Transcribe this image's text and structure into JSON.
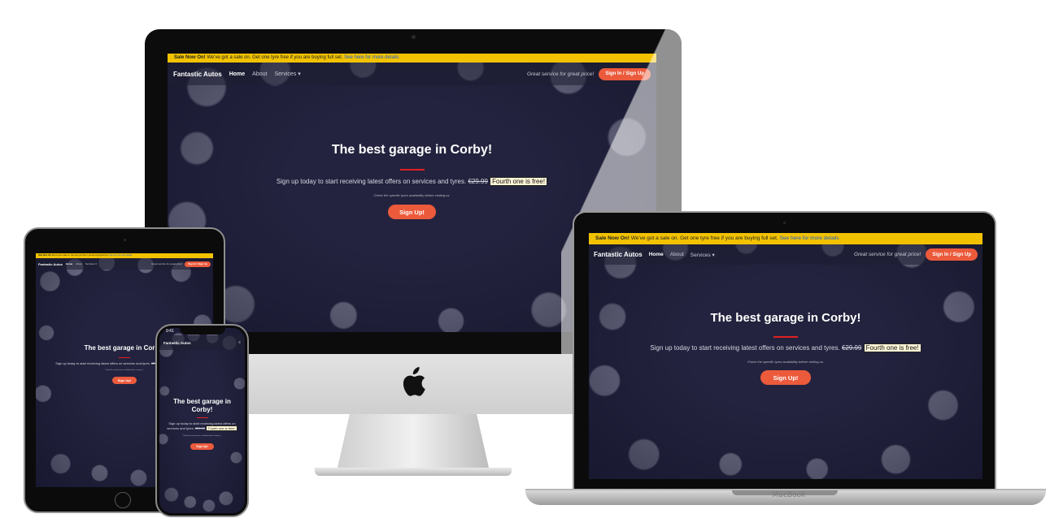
{
  "site": {
    "sale_label": "Sale Now On!",
    "sale_text": "We've got a sale on. Get one tyre free if you are buying full set.",
    "sale_link": "See here for more details",
    "brand": "Fantastic Autos",
    "nav_home": "Home",
    "nav_about": "About",
    "nav_services": "Services",
    "tagline": "Great service for great price!",
    "signin_label": "Sign In / Sign Up",
    "hero_title": "The best garage in Corby!",
    "hero_lead": "Sign up today to start receiving latest offers on services and tyres.",
    "hero_old_price": "€29.99",
    "hero_free": "Fourth one is free!",
    "hero_note": "Check the specific tyres availability before visiting us.",
    "cta_label": "Sign Up!"
  },
  "devices": {
    "laptop_label": "MacBook",
    "phone_time": "9:41"
  },
  "colors": {
    "accent": "#ec5a3c",
    "sale_bar": "#f2c200",
    "hero_bg": "#23233f",
    "divider": "#e02020"
  },
  "icons": {
    "apple": "apple-logo-icon",
    "services_caret": "chevron-down-icon",
    "menu": "hamburger-icon"
  }
}
